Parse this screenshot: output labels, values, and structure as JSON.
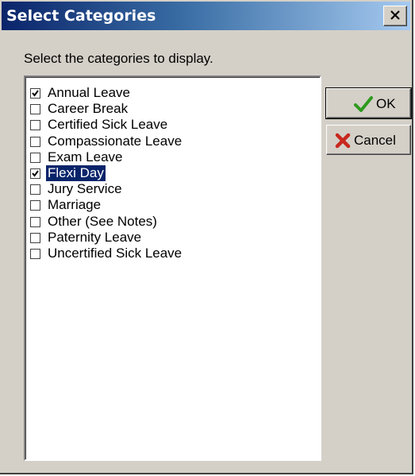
{
  "window": {
    "title": "Select Categories",
    "close_glyph": "close-icon"
  },
  "instruction": "Select the categories to display.",
  "categories": [
    {
      "label": "Annual Leave",
      "checked": true,
      "selected": false
    },
    {
      "label": "Career Break",
      "checked": false,
      "selected": false
    },
    {
      "label": "Certified Sick Leave",
      "checked": false,
      "selected": false
    },
    {
      "label": "Compassionate Leave",
      "checked": false,
      "selected": false
    },
    {
      "label": "Exam Leave",
      "checked": false,
      "selected": false
    },
    {
      "label": "Flexi Day",
      "checked": true,
      "selected": true
    },
    {
      "label": "Jury Service",
      "checked": false,
      "selected": false
    },
    {
      "label": "Marriage",
      "checked": false,
      "selected": false
    },
    {
      "label": "Other (See Notes)",
      "checked": false,
      "selected": false
    },
    {
      "label": "Paternity Leave",
      "checked": false,
      "selected": false
    },
    {
      "label": "Uncertified Sick Leave",
      "checked": false,
      "selected": false
    }
  ],
  "buttons": {
    "ok_label": "OK",
    "ok_icon": "checkmark-icon",
    "cancel_label": "Cancel",
    "cancel_icon": "x-cross-icon"
  },
  "colors": {
    "titlebar_start": "#0a246a",
    "titlebar_end": "#a6caf0",
    "selection": "#0a246a",
    "ok_icon": "#2e9a1e",
    "cancel_icon": "#c8281e"
  }
}
